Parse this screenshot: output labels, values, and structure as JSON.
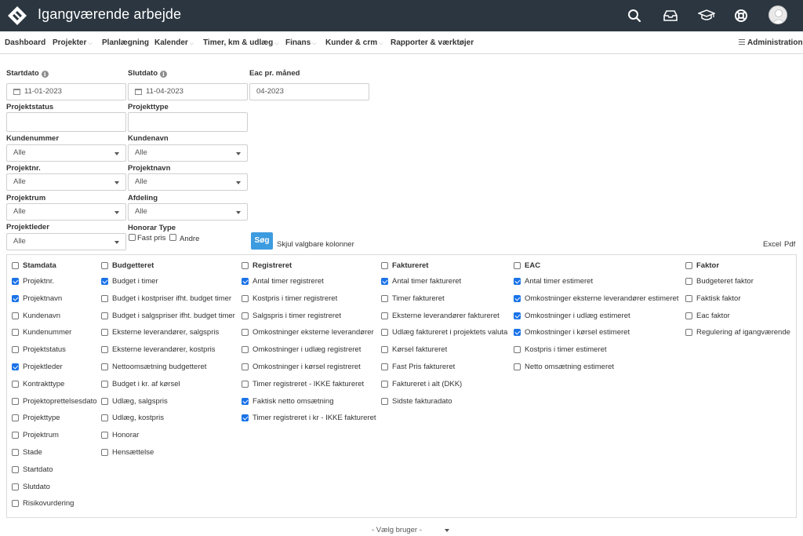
{
  "header": {
    "title": "Igangværende arbejde",
    "icons": [
      "search-icon",
      "inbox-icon",
      "graduation-cap-icon",
      "lifebuoy-icon",
      "user-avatar"
    ]
  },
  "nav": {
    "items": [
      {
        "label": "Dashboard",
        "dropdown": false
      },
      {
        "label": "Projekter",
        "dropdown": true
      },
      {
        "label": "Planlægning",
        "dropdown": false
      },
      {
        "label": "Kalender",
        "dropdown": true
      },
      {
        "label": "Timer, km & udlæg",
        "dropdown": true
      },
      {
        "label": "Finans",
        "dropdown": true
      },
      {
        "label": "Kunder & crm",
        "dropdown": true
      },
      {
        "label": "Rapporter & værktøjer",
        "dropdown": false
      }
    ],
    "admin_label": "Administration"
  },
  "filters": {
    "startdato": {
      "label": "Startdato",
      "value": "11-01-2023"
    },
    "slutdato": {
      "label": "Slutdato",
      "value": "11-04-2023"
    },
    "eac": {
      "label": "Eac pr. måned",
      "value": "04-2023"
    },
    "projektstatus": {
      "label": "Projektstatus",
      "value": ""
    },
    "projekttype": {
      "label": "Projekttype",
      "value": ""
    },
    "kundenummer": {
      "label": "Kundenummer",
      "value": "Alle"
    },
    "kundenavn": {
      "label": "Kundenavn",
      "value": "Alle"
    },
    "projektnr": {
      "label": "Projektnr.",
      "value": "Alle"
    },
    "projektnavn": {
      "label": "Projektnavn",
      "value": "Alle"
    },
    "projektrum": {
      "label": "Projektrum",
      "value": "Alle"
    },
    "afdeling": {
      "label": "Afdeling",
      "value": "Alle"
    },
    "projektleder": {
      "label": "Projektleder",
      "value": "Alle"
    },
    "honorar": {
      "label": "Honorar Type",
      "fast_pris": "Fast pris",
      "andre": "Andre"
    }
  },
  "actions": {
    "search": "Søg",
    "hide_columns": "Skjul valgbare kolonner",
    "excel": "Excel",
    "pdf": "Pdf"
  },
  "columns": [
    {
      "title": "Stamdata",
      "items": [
        {
          "label": "Projektnr.",
          "checked": true
        },
        {
          "label": "Projektnavn",
          "checked": true
        },
        {
          "label": "Kundenavn",
          "checked": false
        },
        {
          "label": "Kundenummer",
          "checked": false
        },
        {
          "label": "Projektstatus",
          "checked": false
        },
        {
          "label": "Projektleder",
          "checked": true
        },
        {
          "label": "Kontrakttype",
          "checked": false
        },
        {
          "label": "Projektoprettelsesdato",
          "checked": false
        },
        {
          "label": "Projekttype",
          "checked": false
        },
        {
          "label": "Projektrum",
          "checked": false
        },
        {
          "label": "Stade",
          "checked": false
        },
        {
          "label": "Startdato",
          "checked": false
        },
        {
          "label": "Slutdato",
          "checked": false
        },
        {
          "label": "Risikovurdering",
          "checked": false
        }
      ]
    },
    {
      "title": "Budgetteret",
      "items": [
        {
          "label": "Budget i timer",
          "checked": true
        },
        {
          "label": "Budget i kostpriser ifht. budget timer",
          "checked": false
        },
        {
          "label": "Budget i salgspriser ifht. budget timer",
          "checked": false
        },
        {
          "label": "Eksterne leverandører, salgspris",
          "checked": false
        },
        {
          "label": "Eksterne leverandører, kostpris",
          "checked": false
        },
        {
          "label": "Nettoomsætning budgetteret",
          "checked": false
        },
        {
          "label": "Budget i kr. af kørsel",
          "checked": false
        },
        {
          "label": "Udlæg, salgspris",
          "checked": false
        },
        {
          "label": "Udlæg, kostpris",
          "checked": false
        },
        {
          "label": "Honorar",
          "checked": false
        },
        {
          "label": "Hensættelse",
          "checked": false
        }
      ]
    },
    {
      "title": "Registreret",
      "items": [
        {
          "label": "Antal timer registreret",
          "checked": true
        },
        {
          "label": "Kostpris i timer registreret",
          "checked": false
        },
        {
          "label": "Salgspris i timer registreret",
          "checked": false
        },
        {
          "label": "Omkostninger eksterne leverandører",
          "checked": false
        },
        {
          "label": "Omkostninger i udlæg registreret",
          "checked": false
        },
        {
          "label": "Omkostninger i kørsel registreret",
          "checked": false
        },
        {
          "label": "Timer registreret - IKKE faktureret",
          "checked": false
        },
        {
          "label": "Faktisk netto omsætning",
          "checked": true
        },
        {
          "label": "Timer registreret i kr - IKKE faktureret",
          "checked": true
        }
      ]
    },
    {
      "title": "Faktureret",
      "items": [
        {
          "label": "Antal timer faktureret",
          "checked": true
        },
        {
          "label": "Timer faktureret",
          "checked": false
        },
        {
          "label": "Eksterne leverandører faktureret",
          "checked": false
        },
        {
          "label": "Udlæg faktureret i projektets valuta",
          "checked": false
        },
        {
          "label": "Kørsel faktureret",
          "checked": false
        },
        {
          "label": "Fast Pris faktureret",
          "checked": false
        },
        {
          "label": "Faktureret i alt (DKK)",
          "checked": false
        },
        {
          "label": "Sidste fakturadato",
          "checked": false
        }
      ]
    },
    {
      "title": "EAC",
      "items": [
        {
          "label": "Antal timer estimeret",
          "checked": true
        },
        {
          "label": "Omkostninger eksterne leverandører estimeret",
          "checked": true
        },
        {
          "label": "Omkostninger i udlæg estimeret",
          "checked": true
        },
        {
          "label": "Omkostninger i kørsel estimeret",
          "checked": true
        },
        {
          "label": "Kostpris i timer estimeret",
          "checked": false
        },
        {
          "label": "Netto omsætning estimeret",
          "checked": false
        }
      ]
    },
    {
      "title": "Faktor",
      "items": [
        {
          "label": "Budgeteret faktor",
          "checked": false
        },
        {
          "label": "Faktisk faktor",
          "checked": false
        },
        {
          "label": "Eac faktor",
          "checked": false
        },
        {
          "label": "Regulering af igangværende",
          "checked": false
        }
      ]
    }
  ],
  "footer": {
    "user_select": "- Vælg bruger -"
  },
  "colors": {
    "topbar": "#2b3640",
    "accent": "#3d9be0",
    "checkbox": "#1a73e8"
  }
}
